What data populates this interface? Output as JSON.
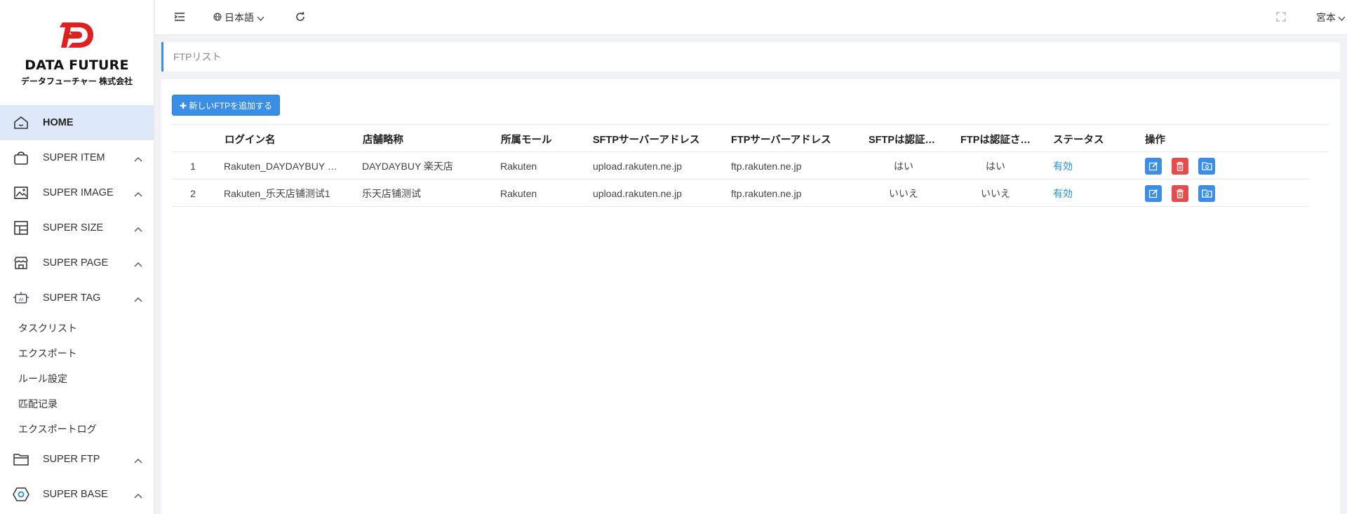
{
  "brand": {
    "title": "DATA FUTURE",
    "subtitle": "データフューチャー 株式会社"
  },
  "sidebar": {
    "items": [
      {
        "label": "HOME",
        "icon": "home-icon",
        "active": true
      },
      {
        "label": "SUPER ITEM",
        "icon": "bag-icon"
      },
      {
        "label": "SUPER IMAGE",
        "icon": "image-icon"
      },
      {
        "label": "SUPER SIZE",
        "icon": "layout-icon"
      },
      {
        "label": "SUPER PAGE",
        "icon": "store-icon"
      },
      {
        "label": "SUPER TAG",
        "icon": "ai-robot-icon"
      },
      {
        "label": "SUPER FTP",
        "icon": "folder-icon"
      },
      {
        "label": "SUPER BASE",
        "icon": "hexagon-icon"
      }
    ],
    "subitems": [
      "タスクリスト",
      "エクスポート",
      "ルール設定",
      "匹配记录",
      "エクスポートログ"
    ]
  },
  "header": {
    "language": "日本語",
    "user": "宮本"
  },
  "breadcrumb": "FTPリスト",
  "toolbar": {
    "add_label": "✚ 新しいFTPを追加する"
  },
  "table": {
    "columns": [
      "ログイン名",
      "店舗略称",
      "所属モール",
      "SFTPサーバーアドレス",
      "FTPサーバーアドレス",
      "SFTPは認証…",
      "FTPは認証さ…",
      "ステータス",
      "操作"
    ],
    "rows": [
      {
        "no": "1",
        "login": "Rakuten_DAYDAYBUY …",
        "shop": "DAYDAYBUY 楽天店",
        "mall": "Rakuten",
        "sftp": "upload.rakuten.ne.jp",
        "ftp": "ftp.rakuten.ne.jp",
        "sftp_auth": "はい",
        "ftp_auth": "はい",
        "status": "有効"
      },
      {
        "no": "2",
        "login": "Rakuten_乐天店铺测试1",
        "shop": "乐天店铺测试",
        "mall": "Rakuten",
        "sftp": "upload.rakuten.ne.jp",
        "ftp": "ftp.rakuten.ne.jp",
        "sftp_auth": "いいえ",
        "ftp_auth": "いいえ",
        "status": "有効"
      }
    ]
  },
  "colors": {
    "accent": "#3a8ee6",
    "danger": "#e74c4c",
    "status": "#1a90d8",
    "logo": "#e02020"
  }
}
